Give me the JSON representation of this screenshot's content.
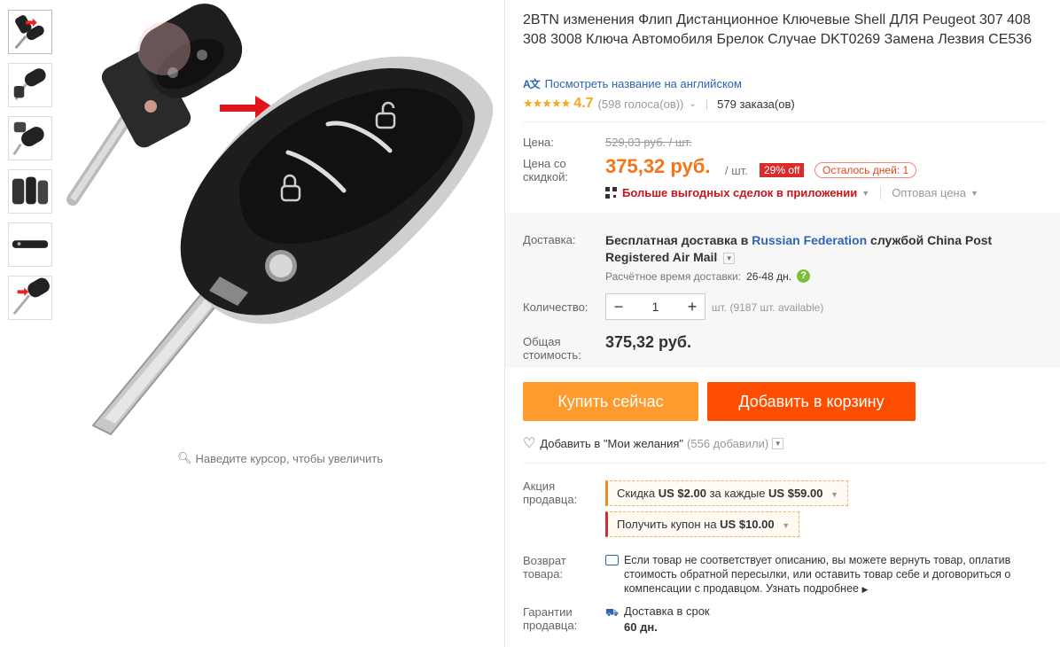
{
  "product": {
    "title": "2BTN изменения Флип Дистанционное Ключевые Shell ДЛЯ Peugeot 307 408 308 3008 Ключа Автомобиля Брелок Случае DKT0269 Замена Лезвия CE536",
    "translate_link": "Посмотреть название на английском",
    "rating": "4.7",
    "votes": "(598 голоса(ов))",
    "orders": "579 заказа(ов)"
  },
  "gallery": {
    "thumbnail_count": 6,
    "zoom_hint": "Наведите курсор, чтобы увеличить"
  },
  "price": {
    "label": "Цена:",
    "old": "529,03 руб. / шт.",
    "sale_label": "Цена со скидкой:",
    "sale": "375,32 руб.",
    "per_unit": "/ шт.",
    "discount": "29% off",
    "days_left": "Осталось дней: 1",
    "app_deals": "Больше выгодных сделок в приложении",
    "wholesale": "Оптовая цена"
  },
  "shipping": {
    "label": "Доставка:",
    "text_prefix": "Бесплатная доставка в ",
    "country": "Russian Federation",
    "text_suffix": " службой China Post Registered Air Mail",
    "eta_label": "Расчётное время доставки:",
    "eta_value": "26-48 дн."
  },
  "quantity": {
    "label": "Количество:",
    "value": "1",
    "minus": "−",
    "plus": "+",
    "available": "шт. (9187 шт. available)"
  },
  "total": {
    "label": "Общая стоимость:",
    "value": "375,32 руб."
  },
  "actions": {
    "buy_now": "Купить сейчас",
    "add_to_cart": "Добавить в корзину",
    "wishlist": "Добавить в \"Мои желания\"",
    "wishlist_count": "(556 добавили)"
  },
  "promo": {
    "label": "Акция продавца:",
    "discount_prefix": "Скидка ",
    "discount_amount": "US $2.00",
    "discount_middle": " за каждые ",
    "discount_threshold": "US $59.00",
    "coupon_prefix": "Получить купон на ",
    "coupon_amount": "US $10.00"
  },
  "returns": {
    "label": "Возврат товара:",
    "text": "Если товар не соответствует описанию, вы можете вернуть товар, оплатив стоимость обратной пересылки, или оставить товар себе и договориться о компенсации с продавцом.",
    "learn_more": "Узнать подробнее"
  },
  "guarantee": {
    "label": "Гарантии продавца:",
    "text": "Доставка в срок",
    "days": "60 дн."
  },
  "colors": {
    "price": "#f5731a",
    "buy_button": "#ff9a2d",
    "cart_button": "#ff4d00",
    "discount_badge": "#d92b2b",
    "link": "#2e64b4",
    "stars": "#f5a623"
  }
}
